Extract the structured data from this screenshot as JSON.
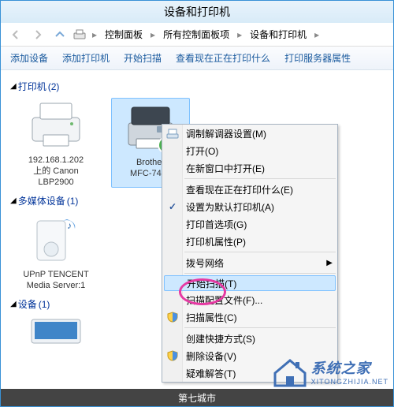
{
  "window": {
    "title": "设备和打印机"
  },
  "breadcrumb": {
    "a": "控制面板",
    "b": "所有控制面板项",
    "c": "设备和打印机"
  },
  "toolbar": {
    "add_device": "添加设备",
    "add_printer": "添加打印机",
    "start_scan": "开始扫描",
    "see_printing": "查看现在正在打印什么",
    "server_props": "打印服务器属性"
  },
  "cats": {
    "printers": {
      "label": "打印机",
      "count": "(2)"
    },
    "multimedia": {
      "label": "多媒体设备",
      "count": "(1)"
    },
    "devices": {
      "label": "设备",
      "count": "(1)"
    }
  },
  "items": {
    "p1": {
      "line1": "192.168.1.202",
      "line2": "上的 Canon",
      "line3": "LBP2900"
    },
    "p2": {
      "line1": "Brother",
      "line2": "MFC-7450"
    },
    "m1": {
      "line1": "UPnP TENCENT",
      "line2": "Media Server:1"
    }
  },
  "ctx": {
    "modem": "调制解调器设置(M)",
    "open": "打开(O)",
    "open_new": "在新窗口中打开(E)",
    "see_printing": "查看现在正在打印什么(E)",
    "set_default": "设置为默认打印机(A)",
    "prefs": "打印首选项(G)",
    "props": "打印机属性(P)",
    "dial": "拨号网络",
    "start_scan": "开始扫描(T)",
    "scan_profile": "扫描配置文件(F)...",
    "scan_props": "扫描属性(C)",
    "shortcut": "创建快捷方式(S)",
    "delete": "删除设备(V)",
    "troubleshoot": "疑难解答(T)"
  },
  "brand": {
    "cn": "系统之家",
    "en": "XITONGZHIJIA.NET"
  },
  "footer": "第七城市"
}
